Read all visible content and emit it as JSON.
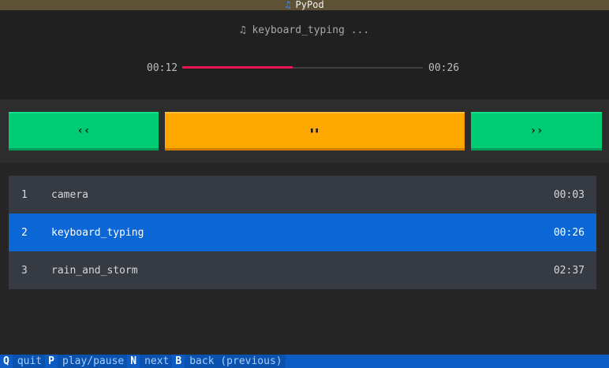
{
  "app": {
    "title": "PyPod",
    "icon": "music-note-icon"
  },
  "player": {
    "now_playing": "♫ keyboard_typing ...",
    "elapsed": "00:12",
    "total": "00:26",
    "progress": 0.46,
    "progress_color": "#e8134f"
  },
  "controls": {
    "prev_label": "‹‹",
    "play_pause_label": "▮▮",
    "next_label": "››"
  },
  "tracks": [
    {
      "num": "1",
      "name": "camera",
      "duration": "00:03"
    },
    {
      "num": "2",
      "name": "keyboard_typing",
      "duration": "00:26",
      "selected": true
    },
    {
      "num": "3",
      "name": "rain_and_storm",
      "duration": "02:37"
    }
  ],
  "footer": {
    "bindings": [
      {
        "key": "Q",
        "desc": "quit"
      },
      {
        "key": "P",
        "desc": "play/pause"
      },
      {
        "key": "N",
        "desc": "next"
      },
      {
        "key": "B",
        "desc": "back (previous)"
      }
    ]
  },
  "colors": {
    "accent_green": "#00cc74",
    "accent_orange": "#ffa800",
    "selection_blue": "#0b66d6"
  }
}
